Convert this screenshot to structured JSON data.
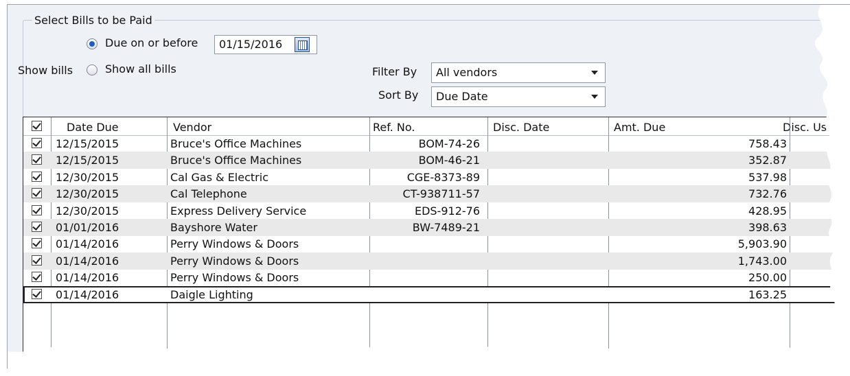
{
  "panel": {
    "group_title": "Select Bills to be Paid",
    "show_bills_label": "Show bills",
    "option_due": "Due on or before",
    "due_date": "01/15/2016",
    "option_all": "Show all bills",
    "filter_label": "Filter By",
    "filter_value": "All vendors",
    "sort_label": "Sort By",
    "sort_value": "Due Date"
  },
  "table": {
    "columns": [
      "Date Due",
      "Vendor",
      "Ref. No.",
      "Disc. Date",
      "Amt. Due",
      "Disc. Us"
    ],
    "rows": [
      {
        "date": "12/15/2015",
        "vendor": "Bruce's Office Machines",
        "ref": "BOM-74-26",
        "disc_date": "",
        "amt": "758.43"
      },
      {
        "date": "12/15/2015",
        "vendor": "Bruce's Office Machines",
        "ref": "BOM-46-21",
        "disc_date": "",
        "amt": "352.87"
      },
      {
        "date": "12/30/2015",
        "vendor": "Cal Gas & Electric",
        "ref": "CGE-8373-89",
        "disc_date": "",
        "amt": "537.98"
      },
      {
        "date": "12/30/2015",
        "vendor": "Cal Telephone",
        "ref": "CT-938711-57",
        "disc_date": "",
        "amt": "732.76"
      },
      {
        "date": "12/30/2015",
        "vendor": "Express Delivery Service",
        "ref": "EDS-912-76",
        "disc_date": "",
        "amt": "428.95"
      },
      {
        "date": "01/01/2016",
        "vendor": "Bayshore Water",
        "ref": "BW-7489-21",
        "disc_date": "",
        "amt": "398.63"
      },
      {
        "date": "01/14/2016",
        "vendor": "Perry Windows & Doors",
        "ref": "",
        "disc_date": "",
        "amt": "5,903.90"
      },
      {
        "date": "01/14/2016",
        "vendor": "Perry Windows & Doors",
        "ref": "",
        "disc_date": "",
        "amt": "1,743.00"
      },
      {
        "date": "01/14/2016",
        "vendor": "Perry Windows & Doors",
        "ref": "",
        "disc_date": "",
        "amt": "250.00"
      },
      {
        "date": "01/14/2016",
        "vendor": "Daigle Lighting",
        "ref": "",
        "disc_date": "",
        "amt": "163.25"
      }
    ]
  }
}
